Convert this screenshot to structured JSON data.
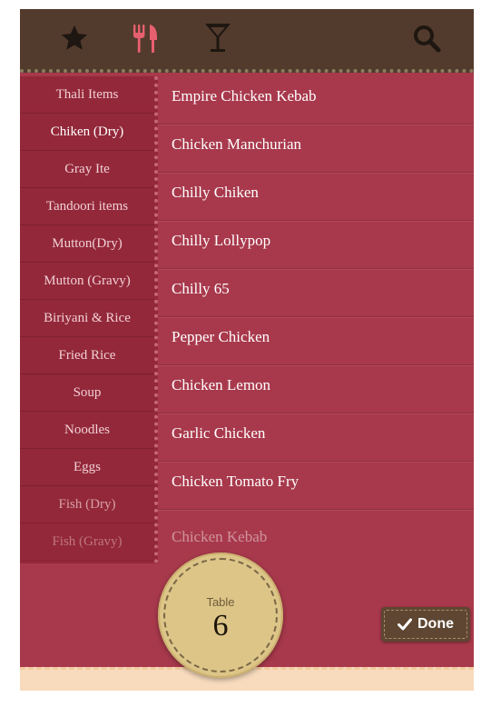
{
  "colors": {
    "accent_active_icon": "#e85f6f",
    "topbar_bg": "#523b2d",
    "content_bg": "#a8394c"
  },
  "topbar": {
    "icons": [
      "star-icon",
      "fork-knife-icon",
      "cocktail-icon",
      "search-icon"
    ],
    "active_icon": "fork-knife-icon"
  },
  "categories": [
    "Thali Items",
    "Chiken (Dry)",
    "Gray Ite",
    "Tandoori items",
    "Mutton(Dry)",
    "Mutton (Gravy)",
    "Biriyani & Rice",
    "Fried Rice",
    "Soup",
    "Noodles",
    "Eggs",
    "Fish (Dry)",
    "Fish (Gravy)"
  ],
  "selected_category": "Chiken (Dry)",
  "menu_items": [
    "Empire Chicken Kebab",
    "Chicken Manchurian",
    "Chilly Chiken",
    "Chilly Lollypop",
    "Chilly 65",
    "Pepper Chicken",
    "Chicken Lemon",
    "Garlic Chicken",
    "Chicken Tomato Fry",
    "Chicken Kebab"
  ],
  "table": {
    "label": "Table",
    "number": "6"
  },
  "done_button": {
    "label": "Done"
  }
}
